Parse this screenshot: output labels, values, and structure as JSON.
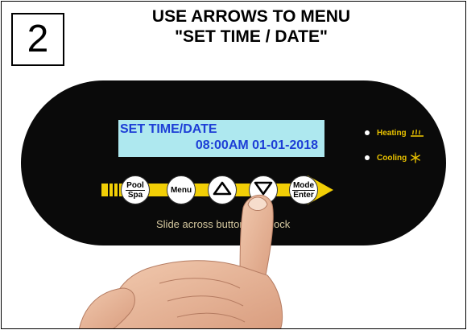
{
  "step_number": "2",
  "instruction": {
    "line1": "USE ARROWS TO MENU",
    "line2": "\"SET TIME / DATE\""
  },
  "lcd": {
    "line1": "SET TIME/DATE",
    "line2": "08:00AM 01-01-2018",
    "background": "#aee8ef",
    "text_color": "#1d3ed6"
  },
  "indicators": {
    "heating": {
      "label": "Heating",
      "icon": "heating-icon"
    },
    "cooling": {
      "label": "Cooling",
      "icon": "snowflake-icon"
    }
  },
  "buttons": {
    "pool_spa": {
      "top": "Pool",
      "bottom": "Spa"
    },
    "menu": {
      "label": "Menu"
    },
    "up": {
      "icon": "up-arrow-icon"
    },
    "down": {
      "icon": "down-arrow-icon"
    },
    "mode_enter": {
      "top": "Mode",
      "bottom": "Enter"
    }
  },
  "hint": "Slide across button to unlock",
  "colors": {
    "panel": "#0a0a0a",
    "accent_yellow": "#f2cf06"
  }
}
